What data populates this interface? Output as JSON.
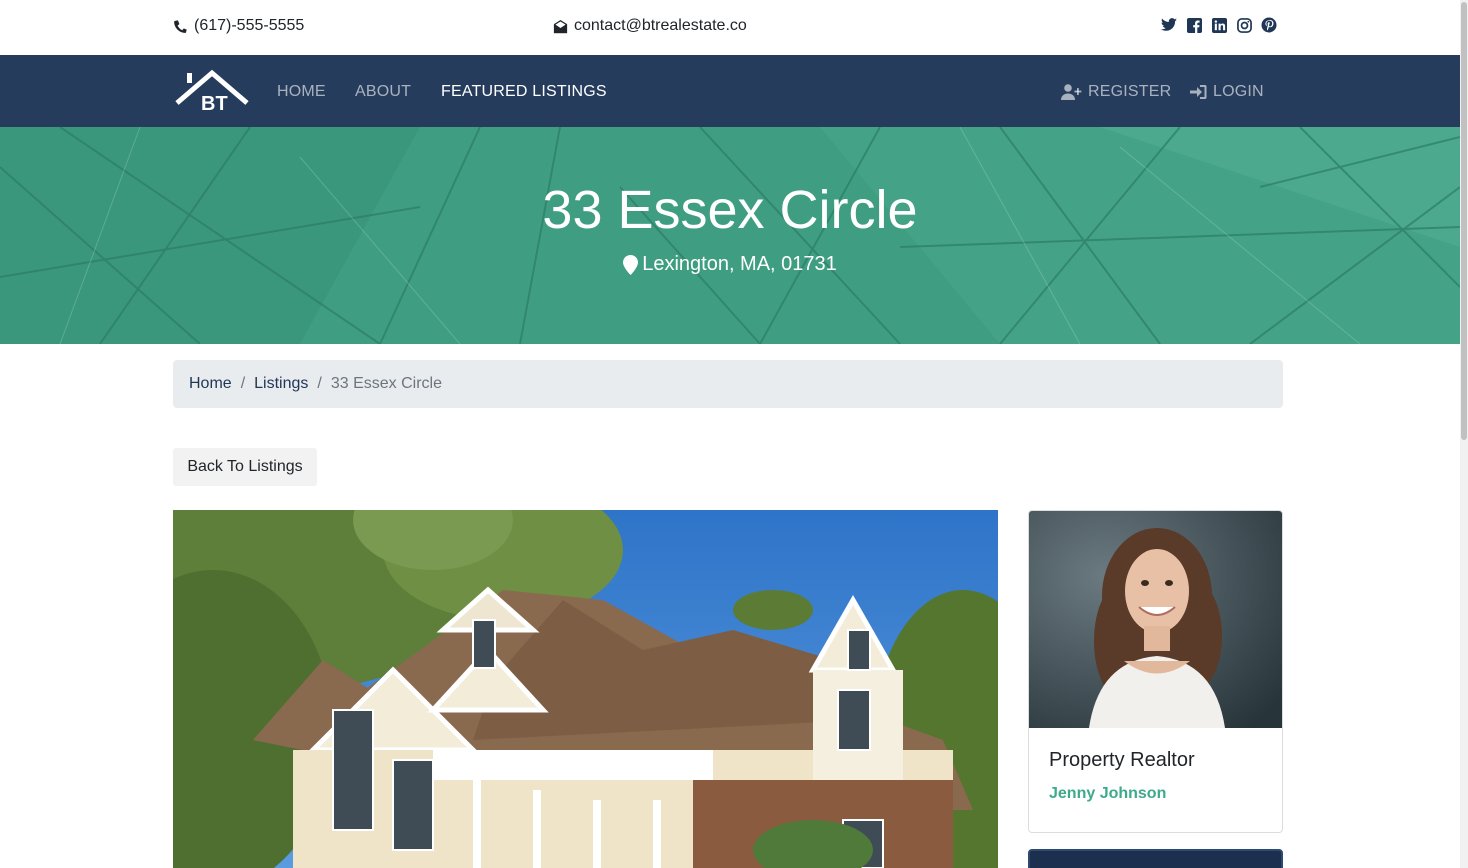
{
  "topbar": {
    "phone": "(617)-555-5555",
    "email": "contact@btrealestate.co",
    "social_icons": [
      "twitter-icon",
      "facebook-icon",
      "linkedin-icon",
      "instagram-icon",
      "pinterest-icon"
    ]
  },
  "nav": {
    "logo_text": "BT",
    "home": "HOME",
    "about": "ABOUT",
    "featured": "FEATURED LISTINGS",
    "register": "REGISTER",
    "login": "LOGIN"
  },
  "hero": {
    "title": "33 Essex Circle",
    "location": "Lexington, MA, 01731"
  },
  "breadcrumb": {
    "home": "Home",
    "listings": "Listings",
    "current": "33 Essex Circle"
  },
  "back_button": "Back To Listings",
  "realtor": {
    "role": "Property Realtor",
    "name": "Jenny Johnson"
  },
  "colors": {
    "navbar": "#263c5c",
    "hero": "#3b9b7f",
    "accent": "#3daa8a"
  }
}
